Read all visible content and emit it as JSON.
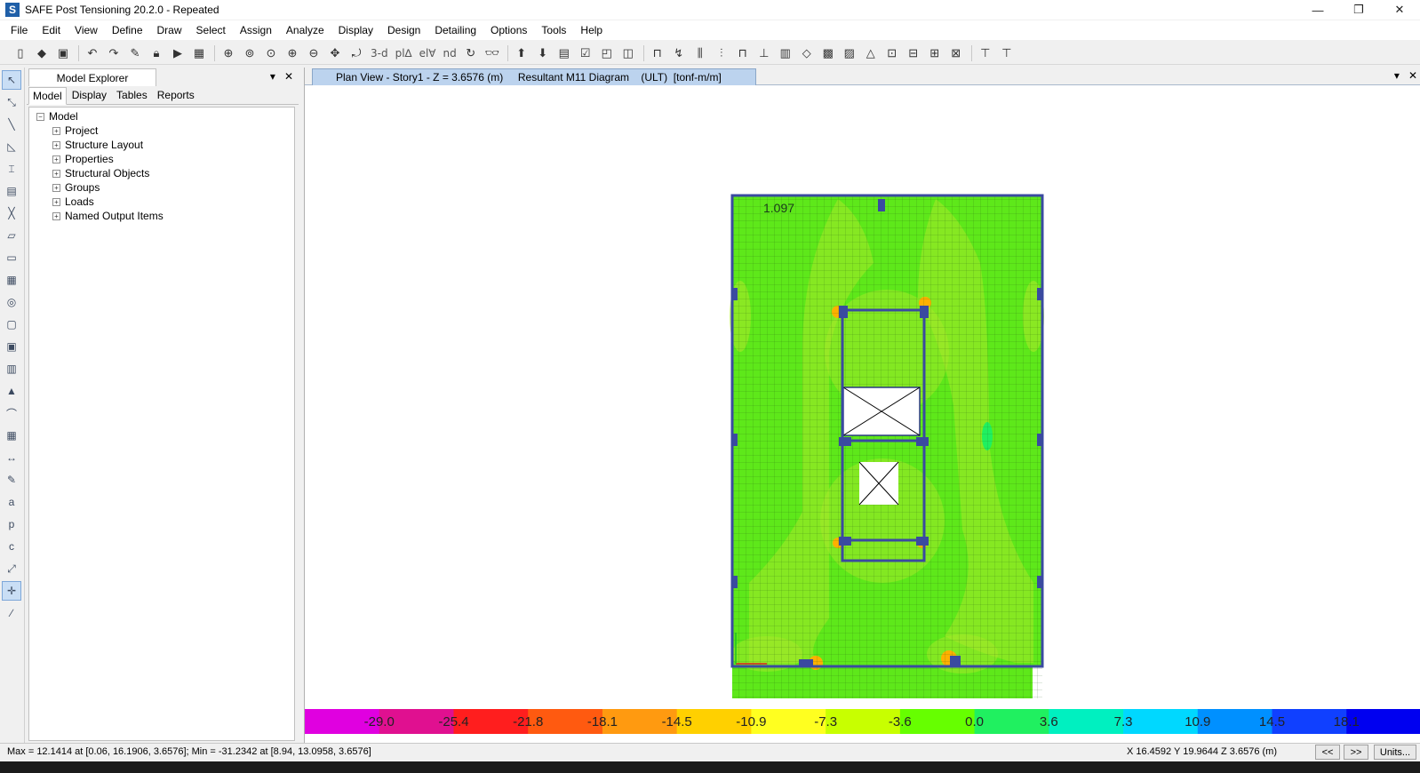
{
  "window": {
    "title": "SAFE Post Tensioning 20.2.0 - Repeated",
    "app_icon_letter": "S",
    "controls": {
      "minimize": "—",
      "restore": "❐",
      "close": "✕"
    }
  },
  "menu": [
    "File",
    "Edit",
    "View",
    "Define",
    "Draw",
    "Select",
    "Assign",
    "Analyze",
    "Display",
    "Design",
    "Detailing",
    "Options",
    "Tools",
    "Help"
  ],
  "toolbar": {
    "view_3d_label": "3-d",
    "plan_label": "pl∆",
    "elev_label": "el∀",
    "nd_label": "nd"
  },
  "explorer": {
    "title": "Model Explorer",
    "tabs": [
      "Model",
      "Display",
      "Tables",
      "Reports"
    ],
    "active_tab": "Model",
    "tree_root": "Model",
    "tree_items": [
      "Project",
      "Structure Layout",
      "Properties",
      "Structural Objects",
      "Groups",
      "Loads",
      "Named Output Items"
    ]
  },
  "view_tab": {
    "title": "Plan View - Story1 - Z = 3.6576 (m)     Resultant M11 Diagram    (ULT)  [tonf-m/m]"
  },
  "plot": {
    "corner_value_label": "1.097"
  },
  "colorbar": {
    "tick_labels": [
      "-29.0",
      "-25.4",
      "-21.8",
      "-18.1",
      "-14.5",
      "-10.9",
      "-7.3",
      "-3.6",
      "0.0",
      "3.6",
      "7.3",
      "10.9",
      "14.5",
      "18.1"
    ],
    "colors": [
      "#e000e0",
      "#e01090",
      "#ff1e1e",
      "#ff5a10",
      "#ff9a10",
      "#ffd000",
      "#ffff20",
      "#c8ff00",
      "#66ff00",
      "#20f060",
      "#00f0c0",
      "#00d8ff",
      "#0090ff",
      "#1040ff",
      "#0000f0"
    ]
  },
  "status": {
    "max_min_text": "Max = 12.1414 at [0.06, 16.1906, 3.6576];  Min = -31.2342 at [8.94, 13.0958, 3.6576]",
    "coords_text": "X 16.4592  Y 19.9644  Z 3.6576 (m)",
    "prev_label": "<<",
    "next_label": ">>",
    "units_label": "Units..."
  },
  "left_tool_icons": [
    "pointer-icon",
    "reshape-icon",
    "draw-line-icon",
    "draw-area-icon",
    "draw-column-icon",
    "draw-beam-icon",
    "draw-brace-icon",
    "draw-slab-icon",
    "draw-rect-icon",
    "draw-wall-icon",
    "draw-opening-icon",
    "draw-drop-icon",
    "draw-strip-icon",
    "draw-tendon-icon",
    "draw-mesh-icon",
    "draw-dimension-icon",
    "draw-rebar-icon",
    "select-all-icon",
    "select-prev-icon",
    "clear-select-icon",
    "snap-icon",
    "snap-grid-icon",
    "snap-line-icon"
  ]
}
